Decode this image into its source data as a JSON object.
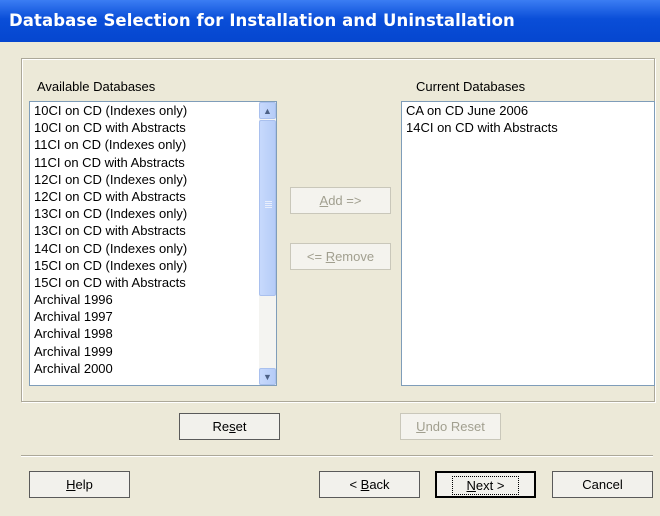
{
  "window": {
    "title": "Database Selection for Installation and Uninstallation"
  },
  "available": {
    "label": "Available Databases",
    "items": [
      "10CI on CD (Indexes only)",
      "10CI on CD with Abstracts",
      "11CI on CD (Indexes only)",
      "11CI on CD with Abstracts",
      "12CI on CD (Indexes only)",
      "12CI on CD with Abstracts",
      "13CI on CD (Indexes only)",
      "13CI on CD with Abstracts",
      "14CI on CD (Indexes only)",
      "15CI on CD (Indexes only)",
      "15CI on CD with Abstracts",
      "Archival 1996",
      "Archival 1997",
      "Archival 1998",
      "Archival 1999",
      "Archival 2000"
    ]
  },
  "current": {
    "label": "Current Databases",
    "items": [
      "CA on CD June 2006",
      "14CI on CD with Abstracts"
    ]
  },
  "buttons": {
    "add": {
      "mnemonic": "A",
      "rest": "dd =>"
    },
    "remove": {
      "pre": "<= ",
      "mnemonic": "R",
      "rest": "emove"
    },
    "reset": {
      "pre": "Re",
      "mnemonic": "s",
      "rest": "et"
    },
    "undo_reset": {
      "mnemonic": "U",
      "rest": "ndo Reset"
    },
    "help": {
      "mnemonic": "H",
      "rest": "elp"
    },
    "back": {
      "pre": "< ",
      "mnemonic": "B",
      "rest": "ack"
    },
    "next": {
      "mnemonic": "N",
      "rest": "ext >"
    },
    "cancel": "Cancel"
  }
}
